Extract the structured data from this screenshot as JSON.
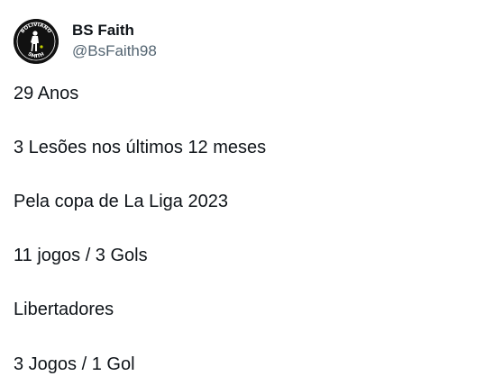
{
  "author": {
    "display_name": "BS Faith",
    "handle": "@BsFaith98",
    "avatar_text_top": "BOLIVIANO",
    "avatar_text_bottom": "SMITH",
    "avatar_icon": "player-silhouette-icon"
  },
  "tweet": {
    "lines": [
      "29 Anos",
      "3 Lesões nos últimos 12 meses",
      "Pela copa de La Liga 2023",
      "11 jogos / 3 Gols",
      "Libertadores",
      "3 Jogos / 1 Gol"
    ]
  },
  "colors": {
    "text_primary": "#0f1419",
    "text_secondary": "#536471",
    "avatar_bg": "#111111",
    "avatar_accent": "#c8d400"
  }
}
